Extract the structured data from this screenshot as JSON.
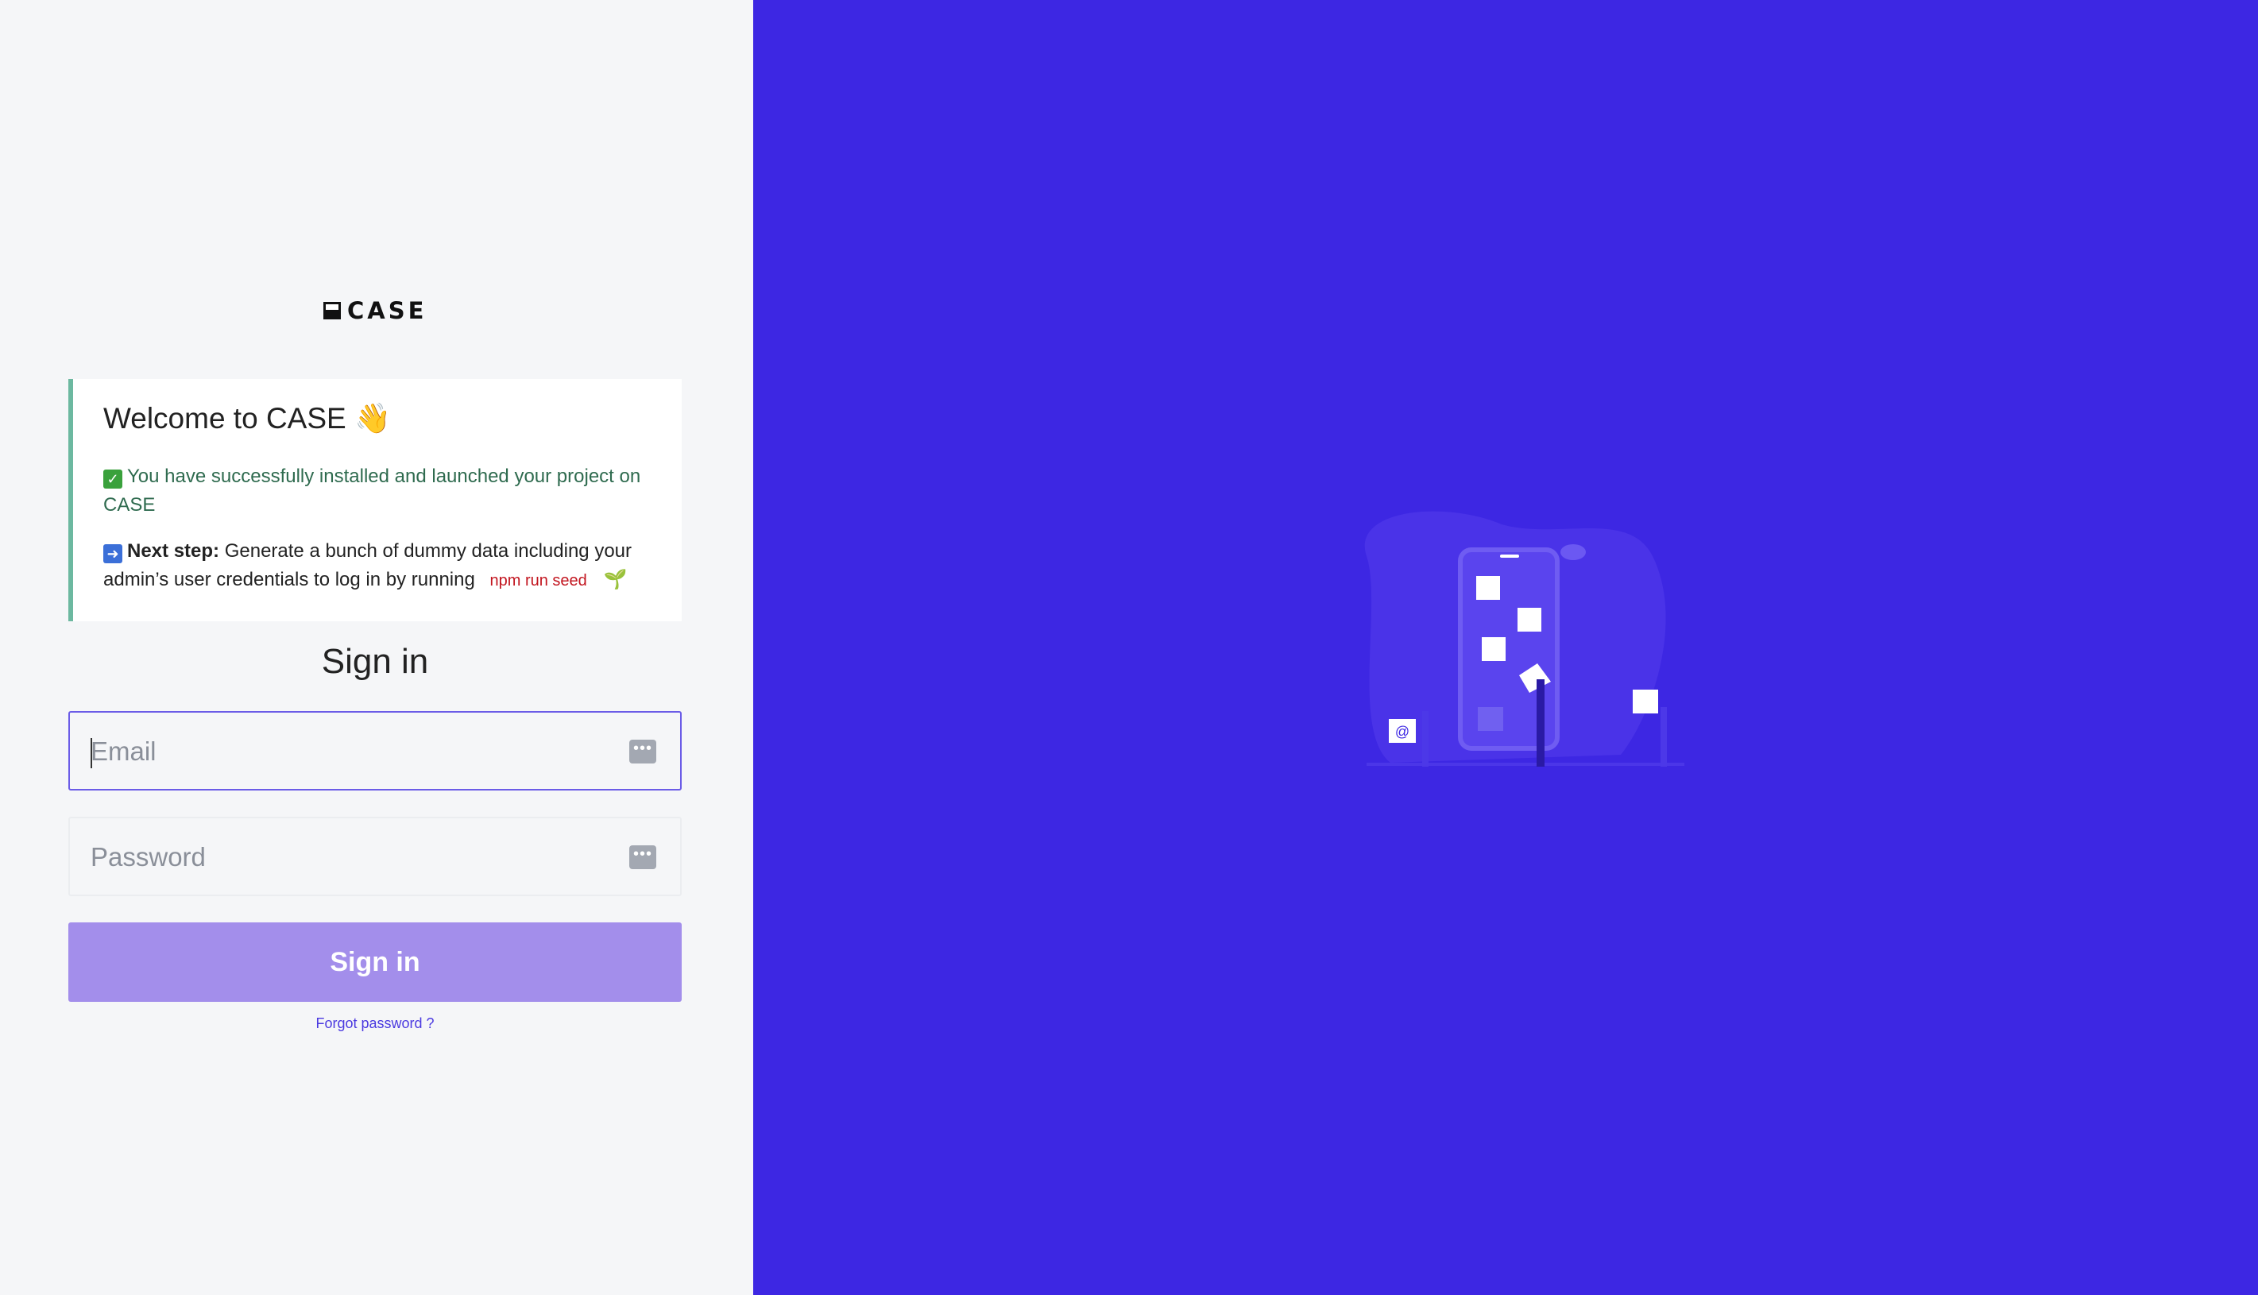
{
  "app": {
    "logo_text": "CASE"
  },
  "welcome": {
    "title": "Welcome to CASE 👋",
    "success_text": "You have successfully installed and launched your project on CASE",
    "next_label": "Next step:",
    "next_text": "Generate a bunch of dummy data including your admin’s user credentials to log in by running",
    "command": "npm run seed",
    "sprout": "🌱"
  },
  "signin": {
    "title": "Sign in",
    "email_placeholder": "Email",
    "password_placeholder": "Password",
    "button_label": "Sign in",
    "forgot_label": "Forgot password ?"
  },
  "icons": {
    "email_field_icon": "password-manager-icon",
    "password_field_icon": "password-manager-icon",
    "illustration": "mobile-marketing-illustration"
  },
  "colors": {
    "accent": "#3d27e3",
    "button": "#a38eeb",
    "card_border": "#6cb8a0",
    "success_text": "#2f6b4f",
    "command_text": "#c2151f"
  }
}
